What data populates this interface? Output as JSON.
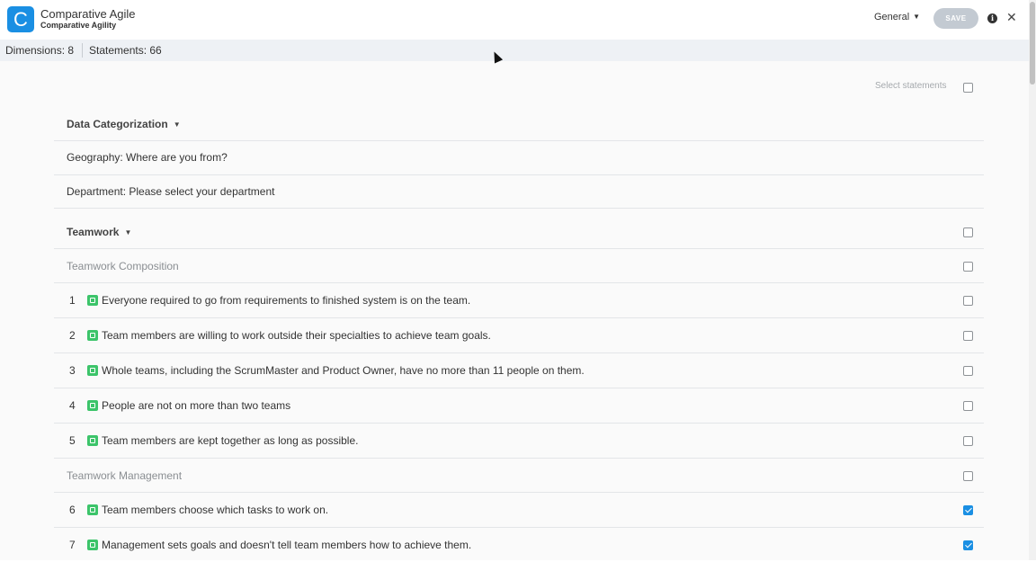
{
  "header": {
    "logo_letter": "C",
    "title": "Comparative Agile",
    "subtitle": "Comparative Agility",
    "general_label": "General",
    "save_label": "SAVE",
    "info_icon": "info-icon",
    "close_icon": "close-icon"
  },
  "stats": {
    "dimensions": "Dimensions: 8",
    "statements": "Statements: 66"
  },
  "main": {
    "select_statements": "Select statements",
    "sections": {
      "data_categorization": "Data Categorization",
      "geography": "Geography: Where are you from?",
      "department": "Department: Please select your department",
      "teamwork": "Teamwork",
      "composition": "Teamwork Composition",
      "management": "Teamwork Management"
    },
    "statements": [
      {
        "num": "1",
        "text": "Everyone required to go from requirements to finished system is on the team.",
        "checked": false
      },
      {
        "num": "2",
        "text": "Team members are willing to work outside their specialties to achieve team goals.",
        "checked": false
      },
      {
        "num": "3",
        "text": "Whole teams, including the ScrumMaster and Product Owner, have no more than 11 people on them.",
        "checked": false
      },
      {
        "num": "4",
        "text": "People are not on more than two teams",
        "checked": false
      },
      {
        "num": "5",
        "text": "Team members are kept together as long as possible.",
        "checked": false
      },
      {
        "num": "6",
        "text": "Team members choose which tasks to work on.",
        "checked": true
      },
      {
        "num": "7",
        "text": "Management sets goals and doesn't tell team members how to achieve them.",
        "checked": true
      }
    ]
  },
  "colors": {
    "brand": "#1a8fe3",
    "edit_icon": "#3cc46a",
    "save_disabled": "#c3cad2"
  }
}
